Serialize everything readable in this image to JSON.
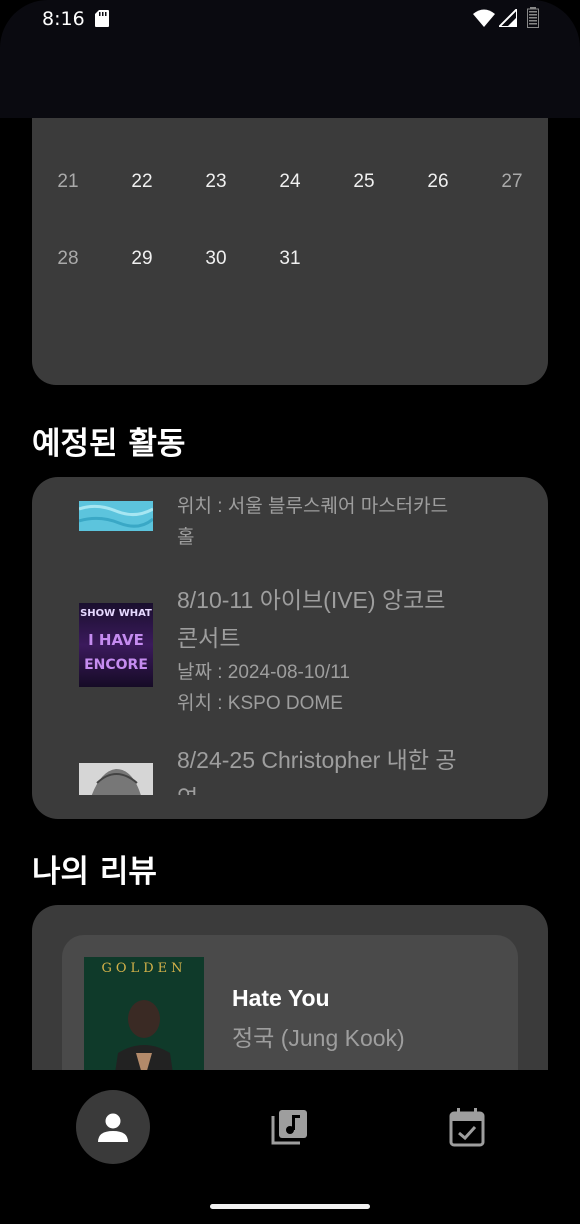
{
  "status_bar": {
    "time": "8:16",
    "icons": [
      "sd-card-icon",
      "wifi-icon",
      "signal-icon",
      "battery-icon"
    ]
  },
  "calendar": {
    "week1": [
      "21",
      "22",
      "23",
      "24",
      "25",
      "26",
      "27"
    ],
    "week2": [
      "28",
      "29",
      "30",
      "31"
    ]
  },
  "upcoming": {
    "title": "예정된 활동",
    "items": [
      {
        "location_line1": "위치 : 서울 블루스퀘어 마스터카드",
        "location_line2": "홀",
        "thumb_icon": "concert-poster-image"
      },
      {
        "title_line1": "8/10-11 아이브(IVE) 앙코르",
        "title_line2": "콘서트",
        "date": "날짜 : 2024-08-10/11",
        "location": "위치 : KSPO DOME",
        "poster_line1": "SHOW WHAT",
        "poster_line2": "I HAVE",
        "poster_line3": "ENCORE"
      },
      {
        "title_line1": "8/24-25 Christopher 내한 공",
        "title_line2": "연",
        "thumb_icon": "concert-poster-image"
      }
    ]
  },
  "reviews": {
    "title": "나의 리뷰",
    "items": [
      {
        "album_text": "GOLDEN",
        "song": "Hate You",
        "artist": "정국 (Jung Kook)"
      }
    ]
  },
  "nav": {
    "items": [
      "profile-icon",
      "music-library-icon",
      "calendar-check-icon"
    ],
    "active": "profile-icon"
  },
  "colors": {
    "background": "#000000",
    "card": "#3b3b3b",
    "inner_card": "#4a4a4a",
    "muted_text": "#9e9e9e"
  }
}
